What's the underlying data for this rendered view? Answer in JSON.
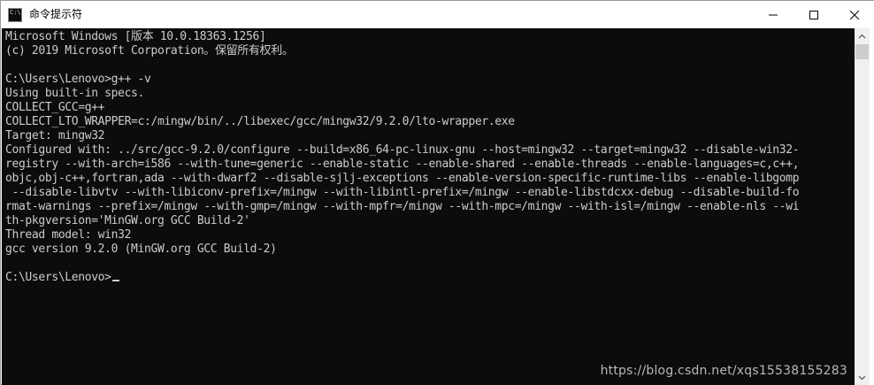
{
  "window": {
    "title": "命令提示符",
    "icon_text": "C:\\"
  },
  "controls": {
    "minimize_icon": "minimize-icon",
    "maximize_icon": "maximize-icon",
    "close_icon": "close-icon"
  },
  "console": {
    "lines": [
      "Microsoft Windows [版本 10.0.18363.1256]",
      "(c) 2019 Microsoft Corporation。保留所有权利。",
      "",
      "C:\\Users\\Lenovo>g++ -v",
      "Using built-in specs.",
      "COLLECT_GCC=g++",
      "COLLECT_LTO_WRAPPER=c:/mingw/bin/../libexec/gcc/mingw32/9.2.0/lto-wrapper.exe",
      "Target: mingw32",
      "Configured with: ../src/gcc-9.2.0/configure --build=x86_64-pc-linux-gnu --host=mingw32 --target=mingw32 --disable-win32-",
      "registry --with-arch=i586 --with-tune=generic --enable-static --enable-shared --enable-threads --enable-languages=c,c++,",
      "objc,obj-c++,fortran,ada --with-dwarf2 --disable-sjlj-exceptions --enable-version-specific-runtime-libs --enable-libgomp",
      " --disable-libvtv --with-libiconv-prefix=/mingw --with-libintl-prefix=/mingw --enable-libstdcxx-debug --disable-build-fo",
      "rmat-warnings --prefix=/mingw --with-gmp=/mingw --with-mpfr=/mingw --with-mpc=/mingw --with-isl=/mingw --enable-nls --wi",
      "th-pkgversion='MinGW.org GCC Build-2'",
      "Thread model: win32",
      "gcc version 9.2.0 (MinGW.org GCC Build-2)",
      ""
    ],
    "prompt": "C:\\Users\\Lenovo>"
  },
  "watermark": "https://blog.csdn.net/xqs15538155283",
  "colors": {
    "console_bg": "#0c0c0c",
    "console_fg": "#cccccc",
    "titlebar_bg": "#ffffff"
  }
}
